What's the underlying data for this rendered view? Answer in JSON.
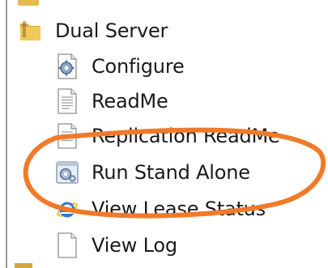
{
  "menu": {
    "folder_label": "Dual Server",
    "items": [
      {
        "label": "Configure",
        "icon": "gear-document-icon"
      },
      {
        "label": "ReadMe",
        "icon": "text-document-icon"
      },
      {
        "label": "Replication ReadMe",
        "icon": "text-document-icon"
      },
      {
        "label": "Run Stand Alone",
        "icon": "gear-app-icon"
      },
      {
        "label": "View Lease Status",
        "icon": "internet-explorer-icon"
      },
      {
        "label": "View Log",
        "icon": "blank-document-icon"
      }
    ]
  },
  "colors": {
    "highlight_ellipse": "#f07a2a",
    "folder": "#e8b84a"
  }
}
